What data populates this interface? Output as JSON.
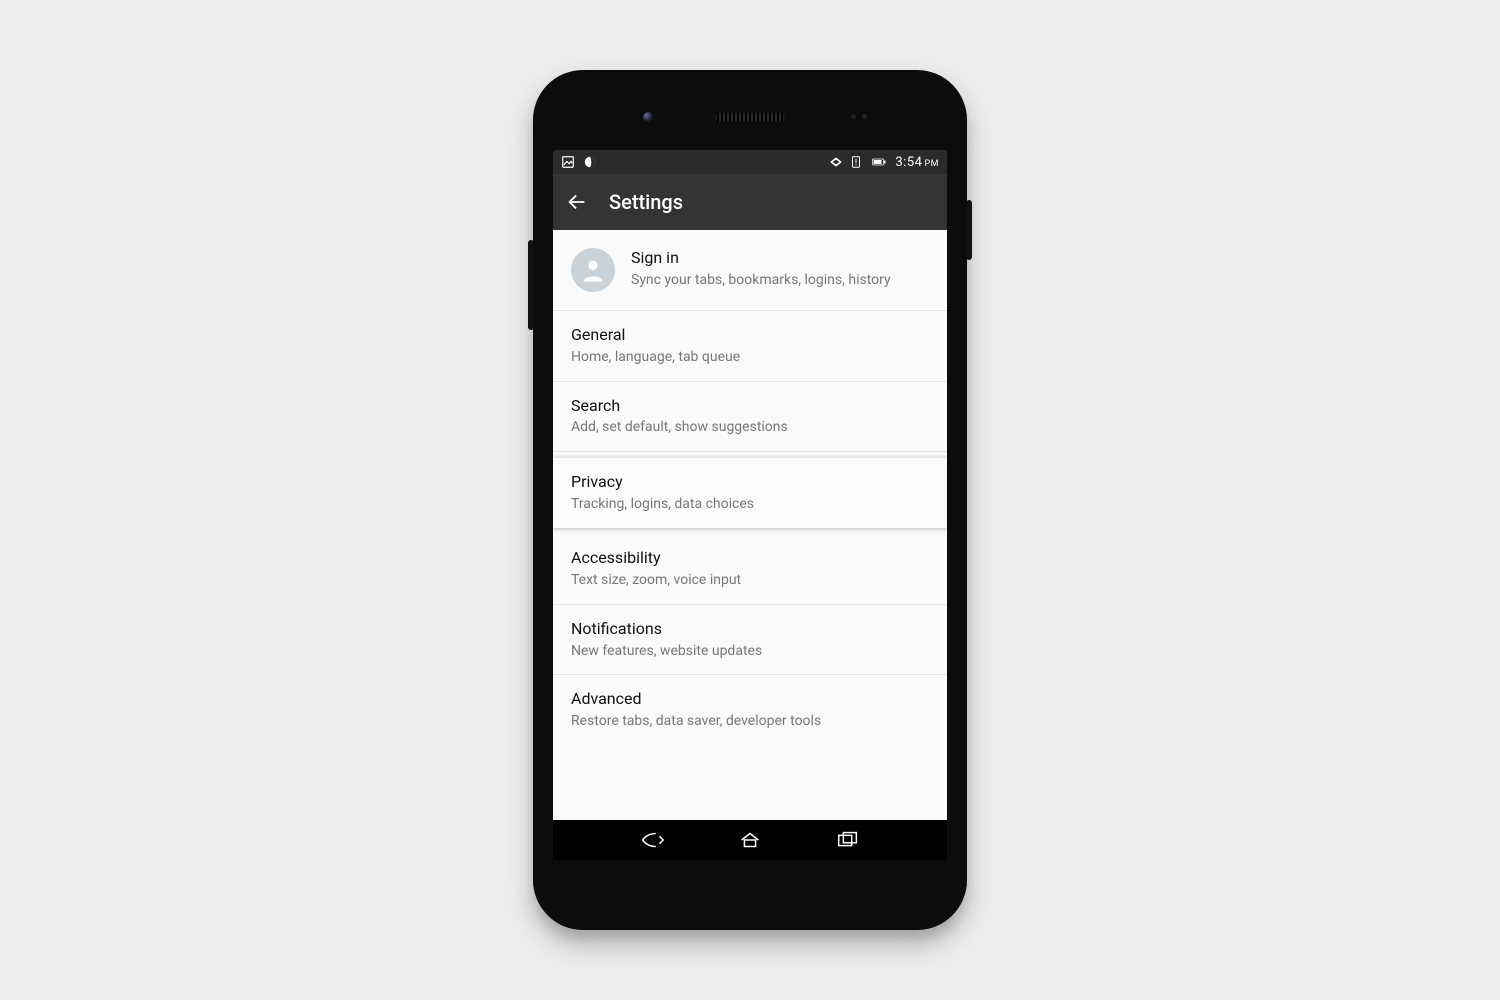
{
  "statusbar": {
    "time": "3:54",
    "ampm": "PM"
  },
  "appbar": {
    "title": "Settings"
  },
  "signin": {
    "title": "Sign in",
    "subtitle": "Sync your tabs, bookmarks, logins, history"
  },
  "items": [
    {
      "title": "General",
      "subtitle": "Home, language, tab queue"
    },
    {
      "title": "Search",
      "subtitle": "Add, set default, show suggestions"
    },
    {
      "title": "Privacy",
      "subtitle": "Tracking, logins, data choices"
    },
    {
      "title": "Accessibility",
      "subtitle": "Text size, zoom, voice input"
    },
    {
      "title": "Notifications",
      "subtitle": "New features, website updates"
    },
    {
      "title": "Advanced",
      "subtitle": "Restore tabs, data saver, developer tools"
    }
  ]
}
